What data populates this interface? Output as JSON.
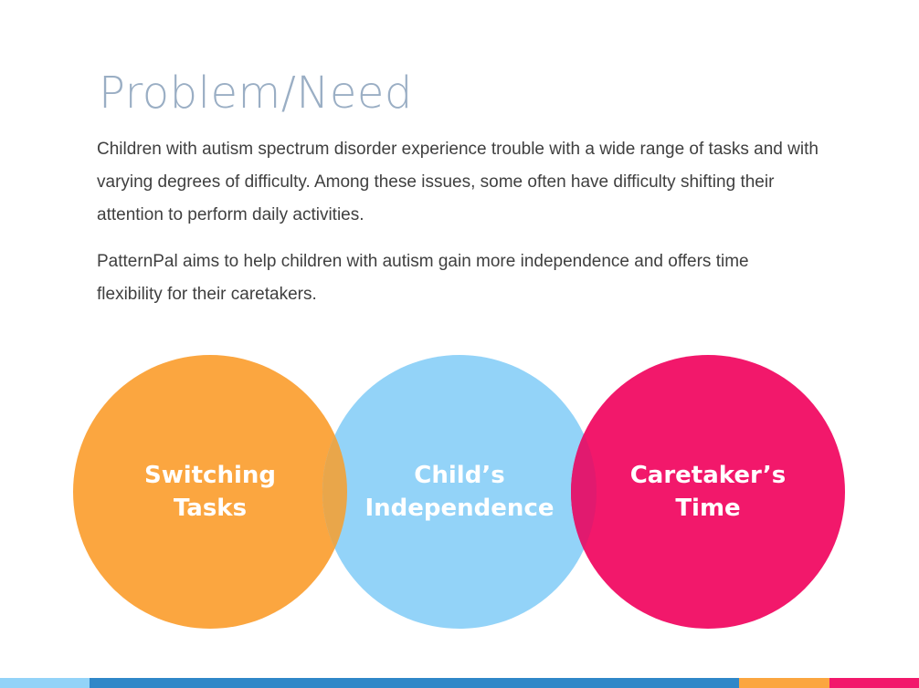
{
  "slide": {
    "title": "Problem/Need",
    "paragraphs": [
      "Children with autism spectrum disorder experience trouble with a wide range of tasks and with varying degrees of difficulty. Among these issues, some often have difficulty shifting their attention to perform daily activities.",
      "PatternPal aims to help children with autism gain more independence and offers time flexibility for their caretakers."
    ],
    "circles": [
      {
        "label": "Switching\nTasks",
        "color": "#fba640"
      },
      {
        "label": "Child’s\nIndependence",
        "color": "#93d3f8"
      },
      {
        "label": "Caretaker’s\nTime",
        "color": "#f2186b"
      }
    ],
    "colors": {
      "title": "#9aaec4",
      "body_text": "#3f3f3f",
      "overlap_orange_blue": "#e9a64a",
      "overlap_blue_pink": "#e11a6f"
    },
    "footer_bar_colors": [
      "#93d3f8",
      "#2f87c8",
      "#fba640",
      "#f2186b"
    ]
  }
}
